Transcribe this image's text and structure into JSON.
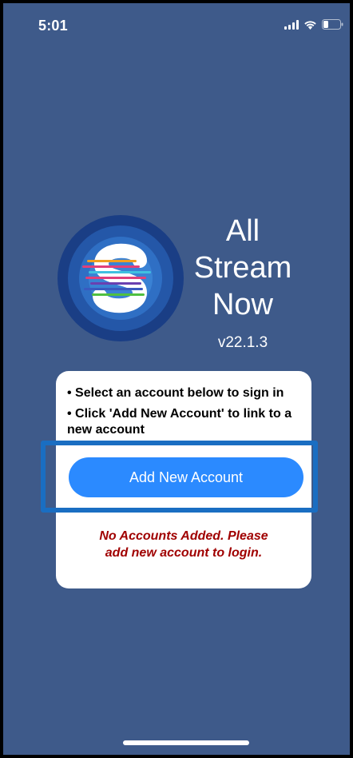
{
  "status_bar": {
    "time": "5:01",
    "icons": [
      "signal-icon",
      "wifi-icon",
      "battery-icon"
    ]
  },
  "app": {
    "title_line1": "All",
    "title_line2": "Stream",
    "title_line3": "Now",
    "version": "v22.1.3",
    "logo": "all-stream-now-logo"
  },
  "card": {
    "instruction_1": "• Select an account below to sign in",
    "instruction_2": "• Click 'Add New Account' to link to a new account",
    "add_button_label": "Add New Account",
    "empty_message_line1": "No Accounts Added. Please",
    "empty_message_line2": "add new account to login."
  },
  "colors": {
    "background": "#3e5a8a",
    "button": "#2b8aff",
    "highlight": "#1a6ec2",
    "empty_message": "#a00000"
  }
}
